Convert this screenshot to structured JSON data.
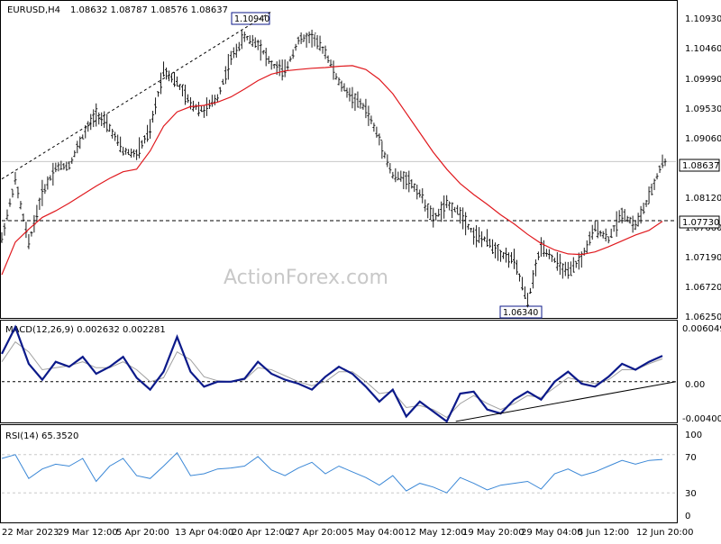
{
  "header": {
    "symbol": "EURUSD,H4",
    "ohlc": "1.08632 1.08787 1.08576 1.08637"
  },
  "watermark": "ActionForex.com",
  "colors": {
    "background": "#ffffff",
    "grid": "#c8c8c8",
    "price_bars": "#1a1a1a",
    "moving_average": "#e0191e",
    "macd": "#0c1a8a",
    "signal": "#a0a0a0",
    "rsi": "#3a87d6",
    "trendline": "#000000",
    "label_border": "#0c1a8a"
  },
  "chart_data": [
    {
      "type": "line",
      "panel": "price",
      "title": "EURUSD,H4 1.08632 1.08787 1.08576 1.08637",
      "ylim": [
        1.0625,
        1.1109
      ],
      "y_ticks": [
        "1.10930",
        "1.10460",
        "1.09990",
        "1.09530",
        "1.09060",
        "1.08120",
        "1.07660",
        "1.07190",
        "1.06720",
        "1.06250"
      ],
      "x_labels": [
        "22 Mar 2023",
        "29 Mar 12:00",
        "5 Apr 20:00",
        "13 Apr 04:00",
        "20 Apr 12:00",
        "27 Apr 20:00",
        "5 May 04:00",
        "12 May 12:00",
        "19 May 20:00",
        "29 May 04:00",
        "5 Jun 12:00",
        "12 Jun 20:00"
      ],
      "annotations": {
        "high_label": "1.10940",
        "low_label": "1.06340",
        "current_price": "1.08637",
        "support_level": "1.07730"
      },
      "levels": {
        "current": 1.08637,
        "support": 1.0773,
        "high": 1.1094,
        "low": 1.0634
      },
      "series": [
        {
          "kind": "price",
          "x": [
            0,
            15,
            30,
            45,
            60,
            75,
            90,
            105,
            120,
            135,
            150,
            165,
            180,
            195,
            210,
            225,
            240,
            255,
            270,
            285,
            300,
            315,
            330,
            345,
            360,
            375,
            390,
            405,
            420,
            435,
            450,
            465,
            480,
            495,
            510,
            525,
            540,
            555,
            570,
            585,
            600,
            615,
            630,
            645,
            660,
            675,
            690,
            705,
            720,
            735
          ],
          "values": [
            1.0745,
            1.0835,
            1.0738,
            1.0815,
            1.0855,
            1.0858,
            1.0902,
            1.0938,
            1.0915,
            1.088,
            1.0875,
            1.0912,
            1.1005,
            1.0985,
            1.0952,
            1.0942,
            1.0962,
            1.1022,
            1.1055,
            1.1045,
            1.1012,
            1.1002,
            1.105,
            1.1055,
            1.1032,
            1.0985,
            1.0962,
            1.0945,
            1.0898,
            1.0842,
            1.0838,
            1.0815,
            1.0775,
            1.0798,
            1.0785,
            1.0752,
            1.0742,
            1.0722,
            1.0712,
            1.0648,
            1.0735,
            1.0712,
            1.0692,
            1.0715,
            1.0762,
            1.0745,
            1.0785,
            1.0765,
            1.0808,
            1.0863
          ]
        },
        {
          "kind": "moving_average",
          "x": [
            0,
            15,
            30,
            45,
            60,
            75,
            90,
            105,
            120,
            135,
            150,
            165,
            180,
            195,
            210,
            225,
            240,
            255,
            270,
            285,
            300,
            315,
            330,
            345,
            360,
            375,
            390,
            405,
            420,
            435,
            450,
            465,
            480,
            495,
            510,
            525,
            540,
            555,
            570,
            585,
            600,
            615,
            630,
            645,
            660,
            675,
            690,
            705,
            720,
            735
          ],
          "values": [
            1.069,
            1.074,
            1.076,
            1.0778,
            1.0788,
            1.08,
            1.0813,
            1.0826,
            1.0838,
            1.0848,
            1.0852,
            1.088,
            1.0918,
            1.094,
            1.0948,
            1.095,
            1.0955,
            1.0963,
            1.0975,
            1.0988,
            1.0998,
            1.1003,
            1.1005,
            1.1007,
            1.1008,
            1.101,
            1.1011,
            1.1005,
            1.099,
            1.0968,
            1.0938,
            1.0908,
            1.0878,
            1.0852,
            1.083,
            1.0813,
            1.0798,
            1.0782,
            1.0768,
            1.0752,
            1.0738,
            1.0728,
            1.0722,
            1.0721,
            1.0725,
            1.0733,
            1.0742,
            1.0751,
            1.0758,
            1.0772
          ]
        }
      ]
    },
    {
      "type": "line",
      "panel": "macd",
      "title": "MACD(12,26,9) 0.002632 0.002281",
      "ylim": [
        -0.004005,
        0.006049
      ],
      "y_ticks": [
        "0.006049",
        "0.00",
        "-0.004005"
      ],
      "series": [
        {
          "kind": "macd",
          "x": [
            0,
            15,
            30,
            45,
            60,
            75,
            90,
            105,
            120,
            135,
            150,
            165,
            180,
            195,
            210,
            225,
            240,
            255,
            270,
            285,
            300,
            315,
            330,
            345,
            360,
            375,
            390,
            405,
            420,
            435,
            450,
            465,
            480,
            495,
            510,
            525,
            540,
            555,
            570,
            585,
            600,
            615,
            630,
            645,
            660,
            675,
            690,
            705,
            720,
            735
          ],
          "values": [
            0.0028,
            0.0055,
            0.0018,
            0.0002,
            0.002,
            0.0015,
            0.0025,
            0.0008,
            0.0015,
            0.0025,
            0.0004,
            -0.0008,
            0.001,
            0.0045,
            0.001,
            -0.0005,
            0.0,
            0.0,
            0.0003,
            0.002,
            0.0008,
            0.0002,
            -0.0002,
            -0.0008,
            0.0005,
            0.0015,
            0.0008,
            -0.0005,
            -0.002,
            -0.0008,
            -0.0035,
            -0.002,
            -0.003,
            -0.004,
            -0.0012,
            -0.001,
            -0.0028,
            -0.0032,
            -0.0018,
            -0.001,
            -0.0018,
            0.0,
            0.001,
            -0.0002,
            -0.0005,
            0.0005,
            0.0018,
            0.0012,
            0.002,
            0.0026
          ]
        },
        {
          "kind": "signal",
          "x": [
            0,
            15,
            30,
            45,
            60,
            75,
            90,
            105,
            120,
            135,
            150,
            165,
            180,
            195,
            210,
            225,
            240,
            255,
            270,
            285,
            300,
            315,
            330,
            345,
            360,
            375,
            390,
            405,
            420,
            435,
            450,
            465,
            480,
            495,
            510,
            525,
            540,
            555,
            570,
            585,
            600,
            615,
            630,
            645,
            660,
            675,
            690,
            705,
            720,
            735
          ],
          "values": [
            0.002,
            0.004,
            0.003,
            0.0012,
            0.0014,
            0.0016,
            0.002,
            0.0014,
            0.0014,
            0.002,
            0.0012,
            0.0,
            0.0004,
            0.003,
            0.0022,
            0.0005,
            0.0001,
            0.0,
            0.0002,
            0.0014,
            0.0012,
            0.0006,
            0.0,
            -0.0004,
            0.0,
            0.001,
            0.001,
            0.0,
            -0.0012,
            -0.001,
            -0.0026,
            -0.0024,
            -0.0028,
            -0.0036,
            -0.0022,
            -0.0014,
            -0.0022,
            -0.0028,
            -0.0022,
            -0.0014,
            -0.0016,
            -0.0006,
            0.0004,
            0.0001,
            -0.0002,
            0.0002,
            0.0012,
            0.0012,
            0.0018,
            0.0023
          ]
        },
        {
          "kind": "trendline",
          "x": [
            505,
            750
          ],
          "values": [
            -0.004,
            0.0
          ]
        }
      ]
    },
    {
      "type": "line",
      "panel": "rsi",
      "title": "RSI(14) 65.3520",
      "ylim": [
        0,
        100
      ],
      "y_ticks": [
        "100",
        "70",
        "30",
        "0"
      ],
      "series": [
        {
          "kind": "rsi",
          "x": [
            0,
            15,
            30,
            45,
            60,
            75,
            90,
            105,
            120,
            135,
            150,
            165,
            180,
            195,
            210,
            225,
            240,
            255,
            270,
            285,
            300,
            315,
            330,
            345,
            360,
            375,
            390,
            405,
            420,
            435,
            450,
            465,
            480,
            495,
            510,
            525,
            540,
            555,
            570,
            585,
            600,
            615,
            630,
            645,
            660,
            675,
            690,
            705,
            720,
            735
          ],
          "values": [
            66,
            70,
            45,
            55,
            60,
            58,
            66,
            42,
            58,
            66,
            48,
            45,
            58,
            72,
            48,
            50,
            55,
            56,
            58,
            68,
            54,
            48,
            56,
            62,
            50,
            58,
            52,
            46,
            38,
            48,
            32,
            40,
            36,
            30,
            46,
            40,
            33,
            38,
            40,
            42,
            34,
            50,
            55,
            48,
            52,
            58,
            64,
            60,
            64,
            65
          ]
        }
      ]
    }
  ]
}
